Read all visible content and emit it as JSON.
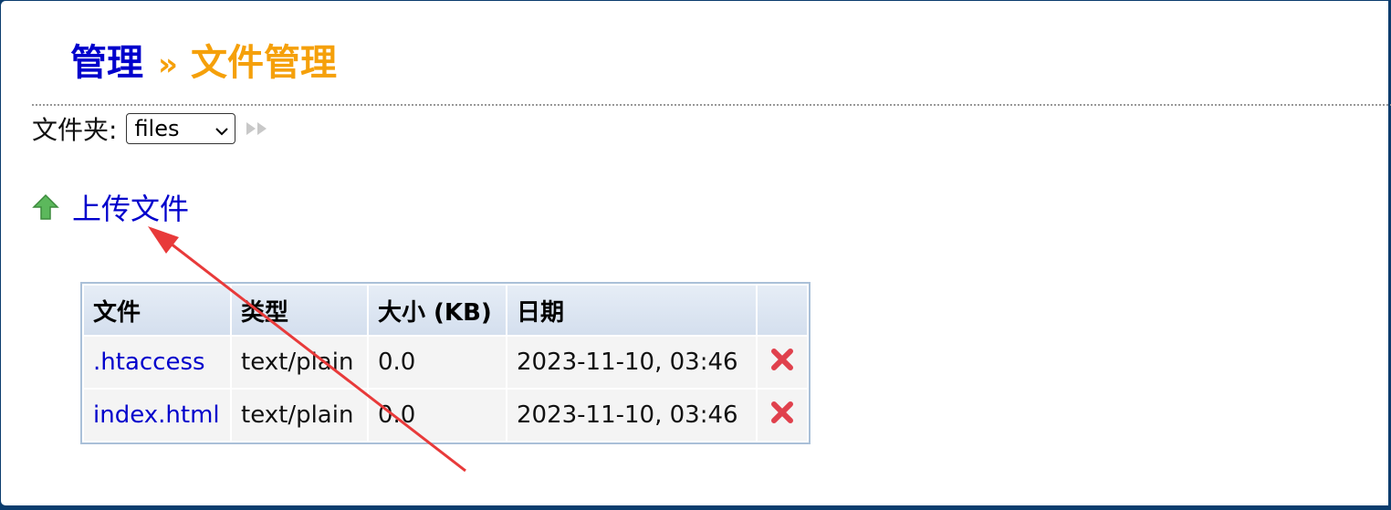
{
  "breadcrumb": {
    "admin_label": "管理",
    "separator": "»",
    "current_label": "文件管理"
  },
  "folder": {
    "label": "文件夹:",
    "selected": "files"
  },
  "upload": {
    "label": "上传文件"
  },
  "table": {
    "headers": [
      "文件",
      "类型",
      "大小 (KB)",
      "日期",
      ""
    ],
    "rows": [
      {
        "file": ".htaccess",
        "type": "text/plain",
        "size": "0.0",
        "date": "2023-11-10, 03:46"
      },
      {
        "file": "index.html",
        "type": "text/plain",
        "size": "0.0",
        "date": "2023-11-10, 03:46"
      }
    ]
  },
  "colors": {
    "link": "#0000cc",
    "accent": "#f5a00a",
    "frame": "#0b3d6e",
    "annotation": "#e83a3a"
  },
  "icons": {
    "go": "double-triangle-right-icon",
    "upload": "green-up-arrow-icon",
    "delete": "red-x-icon"
  }
}
